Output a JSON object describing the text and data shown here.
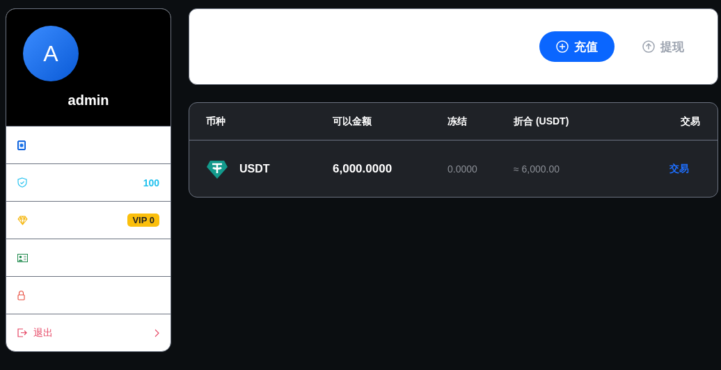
{
  "profile": {
    "avatar_letter": "A",
    "username": "admin"
  },
  "menu": [
    {
      "kind": "contact"
    },
    {
      "kind": "security",
      "value": "100"
    },
    {
      "kind": "vip",
      "badge": "VIP 0"
    },
    {
      "kind": "id-card"
    },
    {
      "kind": "password"
    },
    {
      "kind": "logout",
      "label": "退出"
    }
  ],
  "actions": [
    {
      "kind": "deposit",
      "label": "充值",
      "disabled": false
    },
    {
      "kind": "withdraw",
      "label": "提现",
      "disabled": true
    }
  ],
  "table": {
    "columns": [
      "币种",
      "可以金额",
      "冻结",
      "折合 (USDT)",
      "交易"
    ],
    "rows": [
      {
        "coin": "USDT",
        "available": "6,000.0000",
        "frozen": "0.0000",
        "equivalent": "≈ 6,000.00",
        "action": "交易"
      }
    ]
  }
}
